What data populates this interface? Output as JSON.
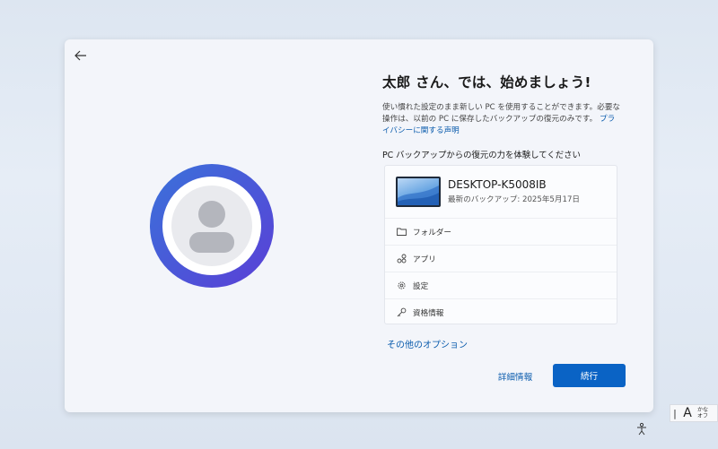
{
  "page": {
    "title": "太郎 さん、では、始めましょう!",
    "description_line1": "使い慣れた設定のまま新しい PC を使用することができます。必要な",
    "description_line2_prefix": "操作は、以前の PC に保存したバックアップの復元のみです。",
    "privacy_link_part1": "プラ",
    "privacy_link_part2": "イバシーに関する声明",
    "section_label": "PC バックアップからの復元の力を体験してください"
  },
  "backup": {
    "device_name": "DESKTOP-K5008IB",
    "last_backup": "最新のバックアップ: 2025年5月17日",
    "items": [
      {
        "label": "フォルダー",
        "icon": "folder-icon"
      },
      {
        "label": "アプリ",
        "icon": "apps-icon"
      },
      {
        "label": "設定",
        "icon": "gear-icon"
      },
      {
        "label": "資格情報",
        "icon": "key-icon"
      }
    ]
  },
  "actions": {
    "other_options": "その他のオプション",
    "details": "詳細情報",
    "next": "続行"
  },
  "ime": {
    "mode": "A",
    "kana_top": "かな",
    "kana_bottom": "オフ"
  },
  "colors": {
    "accent": "#0a63c5",
    "link": "#0b5cad",
    "avatar_ring_start": "#3a6fd8",
    "avatar_ring_end": "#5a3fd6"
  }
}
